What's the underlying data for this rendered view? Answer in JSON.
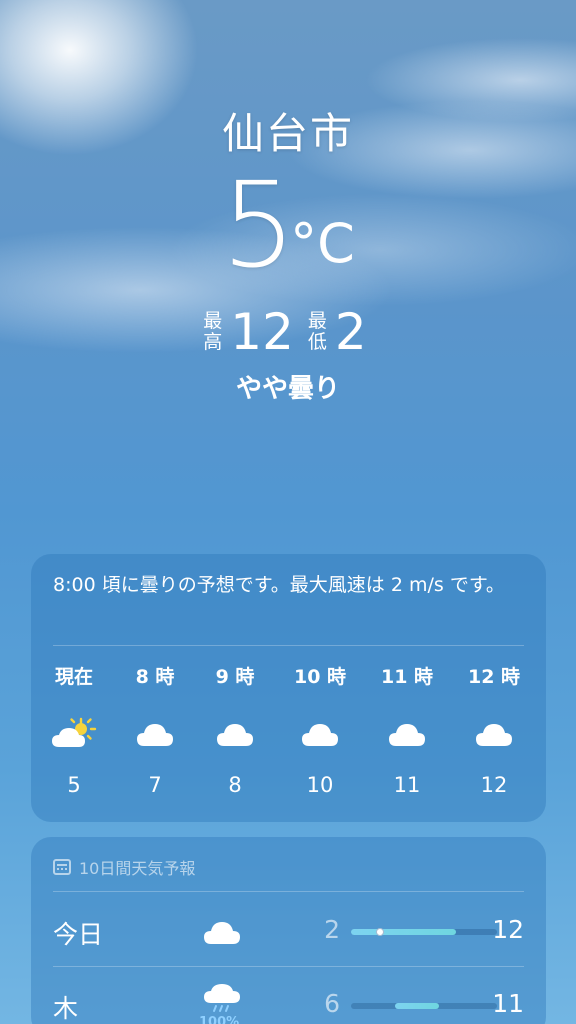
{
  "header": {
    "city": "仙台市",
    "temperature": "5",
    "unit": "°C",
    "high_label_1": "最",
    "high_label_2": "高",
    "high": "12",
    "low_label_1": "最",
    "low_label_2": "低",
    "low": "2",
    "condition": "やや曇り"
  },
  "hourly": {
    "summary": "8:00 頃に曇りの予想です。最大風速は 2 m/s です。",
    "items": [
      {
        "time": "現在",
        "icon": "partly-sunny-icon",
        "temp": "5"
      },
      {
        "time": "8 時",
        "icon": "cloud-icon",
        "temp": "7"
      },
      {
        "time": "9 時",
        "icon": "cloud-icon",
        "temp": "8"
      },
      {
        "time": "10 時",
        "icon": "cloud-icon",
        "temp": "10"
      },
      {
        "time": "11 時",
        "icon": "cloud-icon",
        "temp": "11"
      },
      {
        "time": "12 時",
        "icon": "cloud-icon",
        "temp": "12"
      }
    ]
  },
  "daily": {
    "title": "10日間天気予報",
    "title_icon": "calendar-icon",
    "days": [
      {
        "name": "今日",
        "icon": "cloud-icon",
        "low": "2",
        "high": "12",
        "range_start": 0.0,
        "range_end": 0.72,
        "current": 0.2
      },
      {
        "name": "木",
        "icon": "cloud-rain-icon",
        "pop": "100%",
        "low": "6",
        "high": "11",
        "range_start": 0.3,
        "range_end": 0.6
      }
    ]
  },
  "colors": {
    "sky_top": "#6a9ac6",
    "sky_bottom": "#73b6e3",
    "card_bg": "rgba(45,120,185,0.42)",
    "temp_bar": "#7dd3f0",
    "precip": "#8fd0ff"
  }
}
